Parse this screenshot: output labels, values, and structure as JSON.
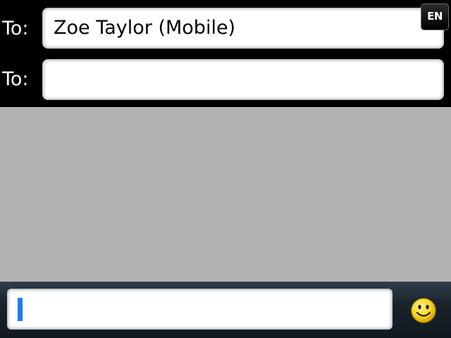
{
  "recipients": {
    "row1": {
      "label": "To:",
      "value": "Zoe Taylor (Mobile)"
    },
    "row2": {
      "label": "To:",
      "value": ""
    }
  },
  "input_language": "EN",
  "compose": {
    "value": ""
  },
  "icons": {
    "emoji": "smiley-icon"
  },
  "colors": {
    "header_bg": "#000000",
    "conversation_bg": "#b1b1b1",
    "cursor": "#1f7fe0",
    "emoji_face": "#f5d21c"
  }
}
